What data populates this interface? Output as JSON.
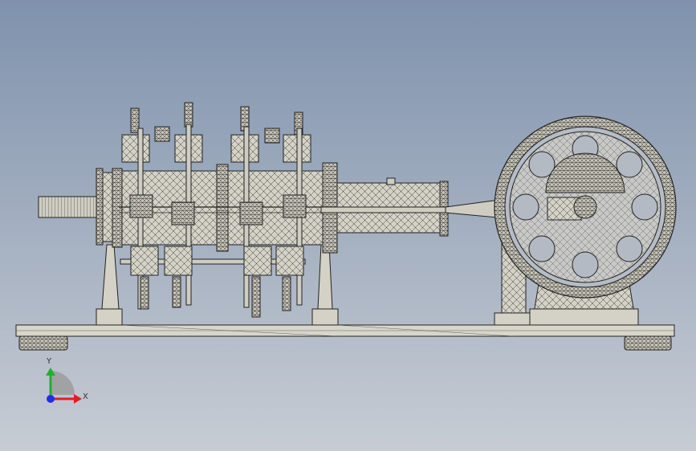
{
  "viewport": {
    "background_top": "#7f92ad",
    "background_bottom": "#c7ccd4",
    "model_fill": "#d4d2c6",
    "edge_color": "#1e1e1e"
  },
  "triad": {
    "x_label": "X",
    "y_label": "Y",
    "x_color": "#e02020",
    "y_color": "#20b030",
    "z_color": "#2030e0"
  },
  "model": {
    "name": "engine-assembly",
    "components": [
      "base-plate",
      "feet",
      "support-struts",
      "crankshaft",
      "cylinder-block",
      "valve-assemblies",
      "connecting-rod",
      "pedestal",
      "flywheel"
    ]
  }
}
